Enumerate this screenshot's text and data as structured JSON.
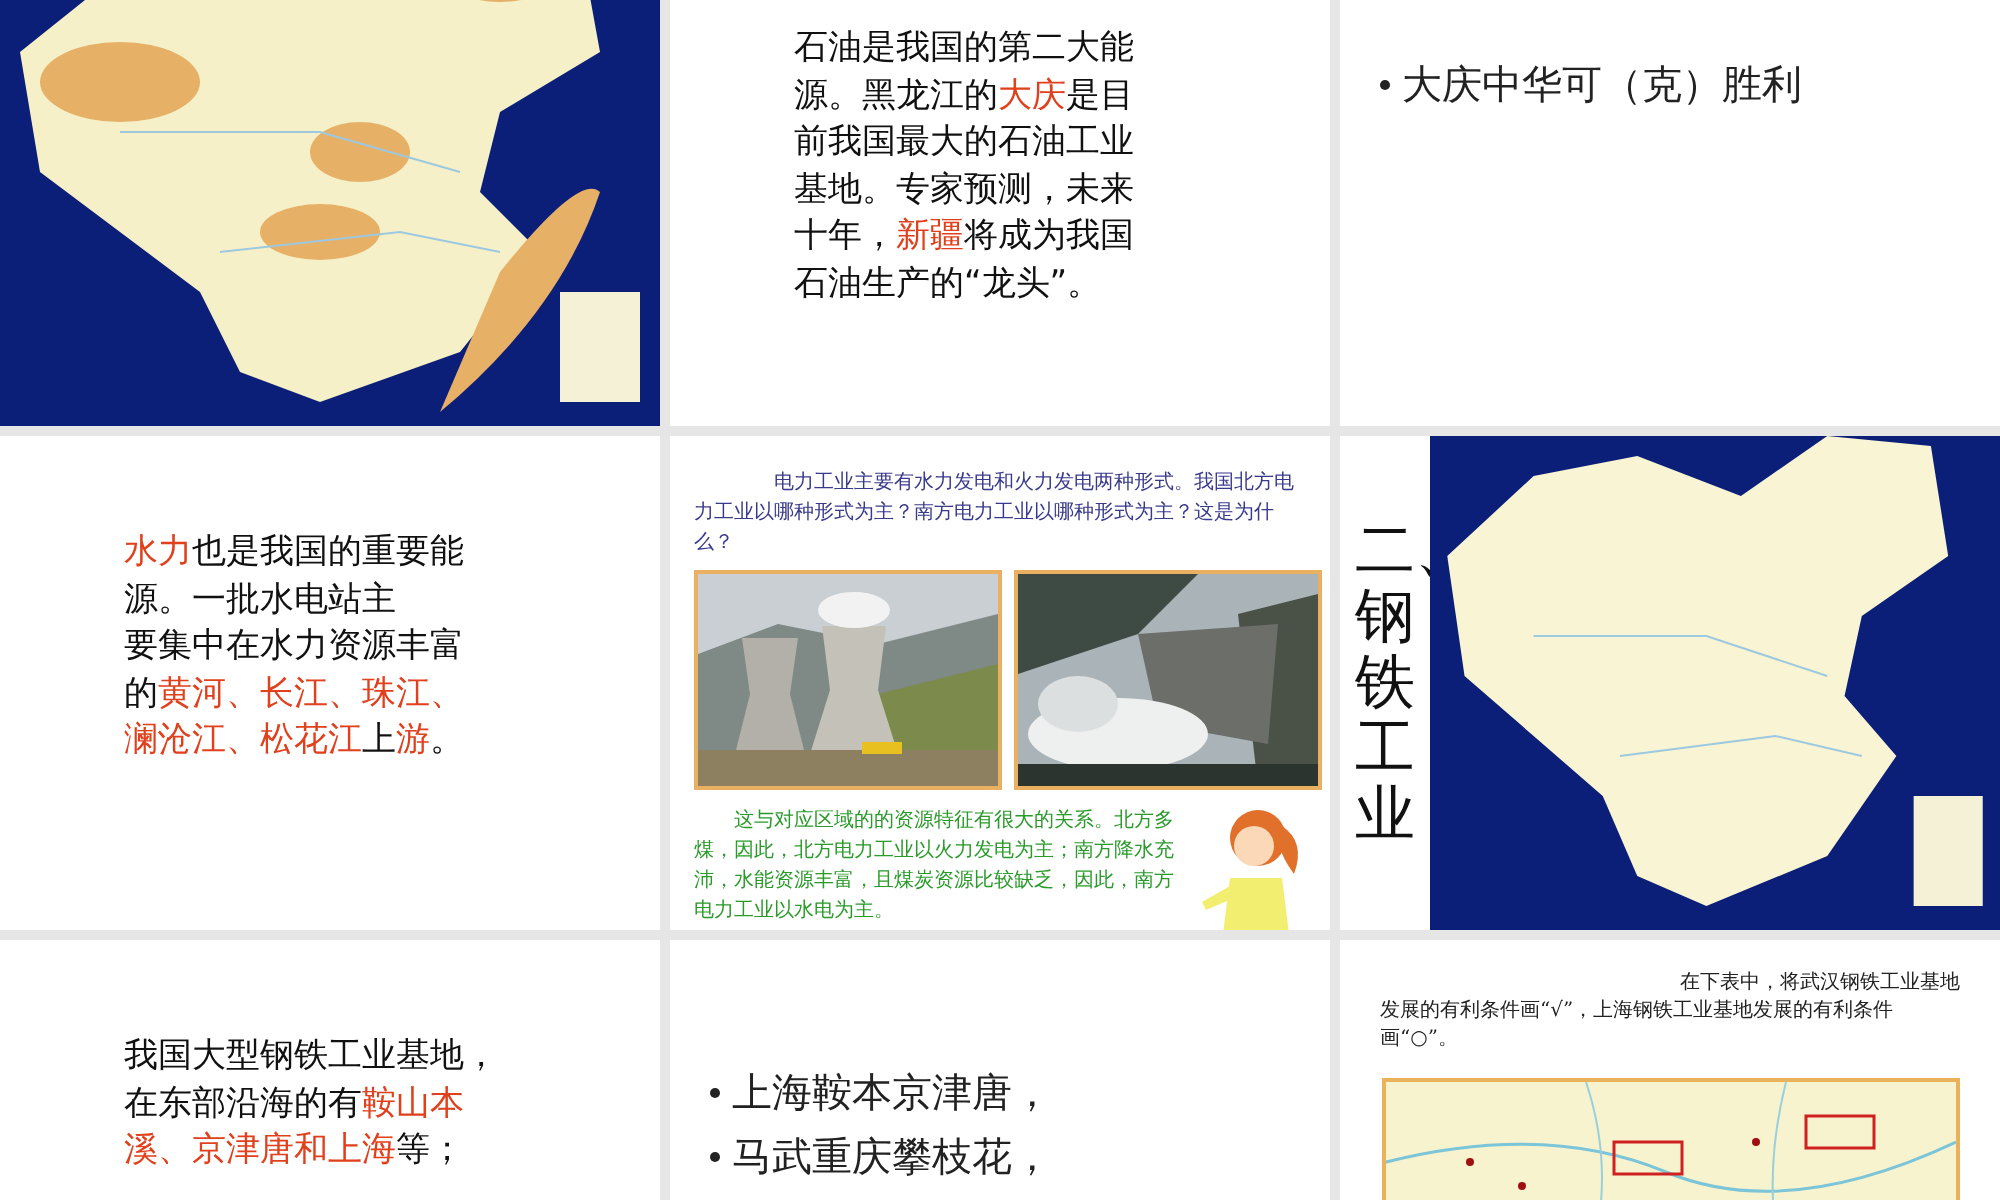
{
  "slides": [
    {
      "kind": "map"
    },
    {
      "kind": "paragraph",
      "lines": [
        [
          {
            "text": "石油是我国的第二大能",
            "highlight": false
          }
        ],
        [
          {
            "text": "源。黑龙江的",
            "highlight": false
          },
          {
            "text": "大庆",
            "highlight": true
          },
          {
            "text": "是目",
            "highlight": false
          }
        ],
        [
          {
            "text": "前我国最大的石油工业",
            "highlight": false
          }
        ],
        [
          {
            "text": "基地。专家预测，未来",
            "highlight": false
          }
        ],
        [
          {
            "text": "十年，",
            "highlight": false
          },
          {
            "text": "新疆",
            "highlight": true
          },
          {
            "text": "将成为我国",
            "highlight": false
          }
        ],
        [
          {
            "text": "石油生产的“龙头”。",
            "highlight": false
          }
        ]
      ]
    },
    {
      "kind": "bullets",
      "items": [
        "大庆中华可（克）胜利"
      ]
    },
    {
      "kind": "paragraph",
      "lines": [
        [
          {
            "text": "水力",
            "highlight": true
          },
          {
            "text": "也是我国的重要能",
            "highlight": false
          }
        ],
        [
          {
            "text": "源。一批水电站主",
            "highlight": false
          }
        ],
        [
          {
            "text": "要集中在水力资源丰富",
            "highlight": false
          }
        ],
        [
          {
            "text": "的",
            "highlight": false
          },
          {
            "text": "黄河、长江、珠江、",
            "highlight": true
          }
        ],
        [
          {
            "text": "澜沧江、松花江",
            "highlight": true
          },
          {
            "text": "上",
            "highlight": false
          },
          {
            "text": "游",
            "highlight": true
          },
          {
            "text": "。",
            "highlight": false
          }
        ]
      ]
    },
    {
      "kind": "qa",
      "question": "电力工业主要有水力发电和火力发电两种形式。我国北方电力工业以哪种形式为主？南方电力工业以哪种形式为主？这是为什么？",
      "answer": "这与对应区域的的资源特征有很大的关系。北方多煤，因此，北方电力工业以火力发电为主；南方降水充沛，水能资源丰富，且煤炭资源比较缺乏，因此，南方电力工业以水电为主。"
    },
    {
      "kind": "title_map",
      "title": "二、钢铁工业"
    },
    {
      "kind": "paragraph",
      "lines": [
        [
          {
            "text": "我国大型钢铁工业基地，",
            "highlight": false
          }
        ],
        [
          {
            "text": "在东部沿海的有",
            "highlight": false
          },
          {
            "text": "鞍山本",
            "highlight": true
          }
        ],
        [
          {
            "text": "溪、京津唐和上海",
            "highlight": true
          },
          {
            "text": "等；",
            "highlight": false
          }
        ]
      ]
    },
    {
      "kind": "bullets",
      "items": [
        "上海鞍本京津唐，",
        "马武重庆攀枝花，"
      ]
    },
    {
      "kind": "exercise",
      "question": "在下表中，将武汉钢铁工业基地发展的有利条件画“√”，上海钢铁工业基地发展的有利条件画“○”。"
    }
  ]
}
